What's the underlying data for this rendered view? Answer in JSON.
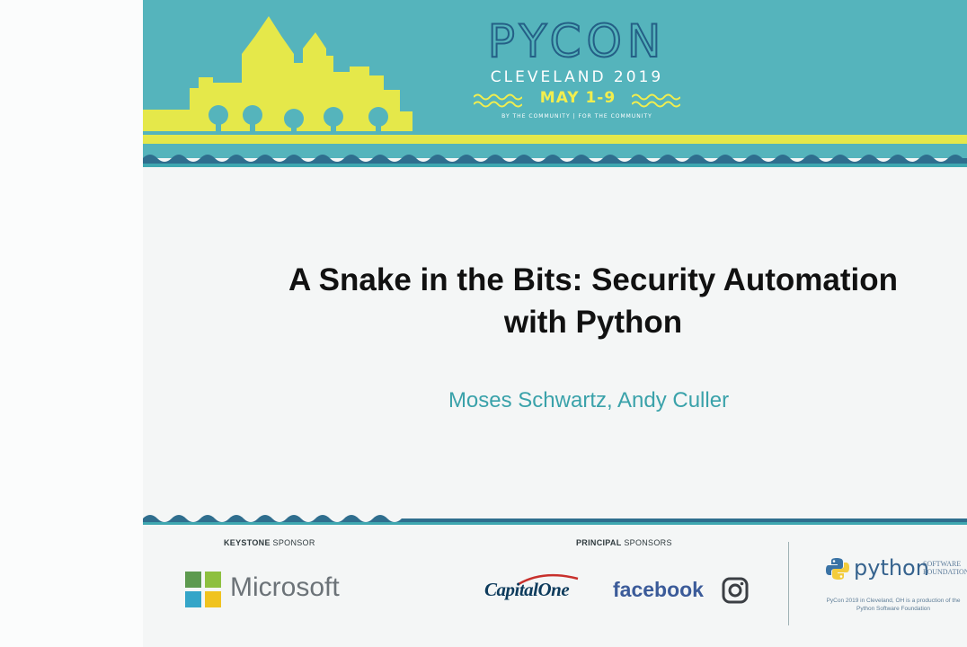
{
  "banner": {
    "event_name": "PYCON",
    "city_year": "CLEVELAND 2019",
    "dates": "MAY 1-9",
    "tagline": "BY THE COMMUNITY | FOR THE COMMUNITY",
    "colors": {
      "teal": "#55b4bc",
      "yellow": "#e5e84a",
      "navy": "#245f86"
    }
  },
  "talk": {
    "title_line1": "A Snake in the Bits: Security Automation",
    "title_line2": "with Python",
    "authors": "Moses Schwartz, Andy Culler"
  },
  "sponsors": {
    "keystone_label_bold": "KEYSTONE",
    "keystone_label_light": " SPONSOR",
    "keystone": [
      {
        "name": "Microsoft",
        "icon": "microsoft-logo-icon"
      }
    ],
    "principal_label_bold": "PRINCIPAL",
    "principal_label_light": " SPONSORS",
    "principal": [
      {
        "name": "CapitalOne",
        "icon": "capital-one-swoosh-icon"
      },
      {
        "name": "facebook",
        "icon": "facebook-wordmark"
      },
      {
        "name": "Instagram",
        "icon": "instagram-icon"
      }
    ]
  },
  "psf": {
    "wordmark": "python",
    "suffix_line1": "SOFTWARE",
    "suffix_line2": "FOUNDATION",
    "note_line1": "PyCon 2019 in Cleveland, OH is a production of the",
    "note_line2": "Python Software Foundation"
  }
}
